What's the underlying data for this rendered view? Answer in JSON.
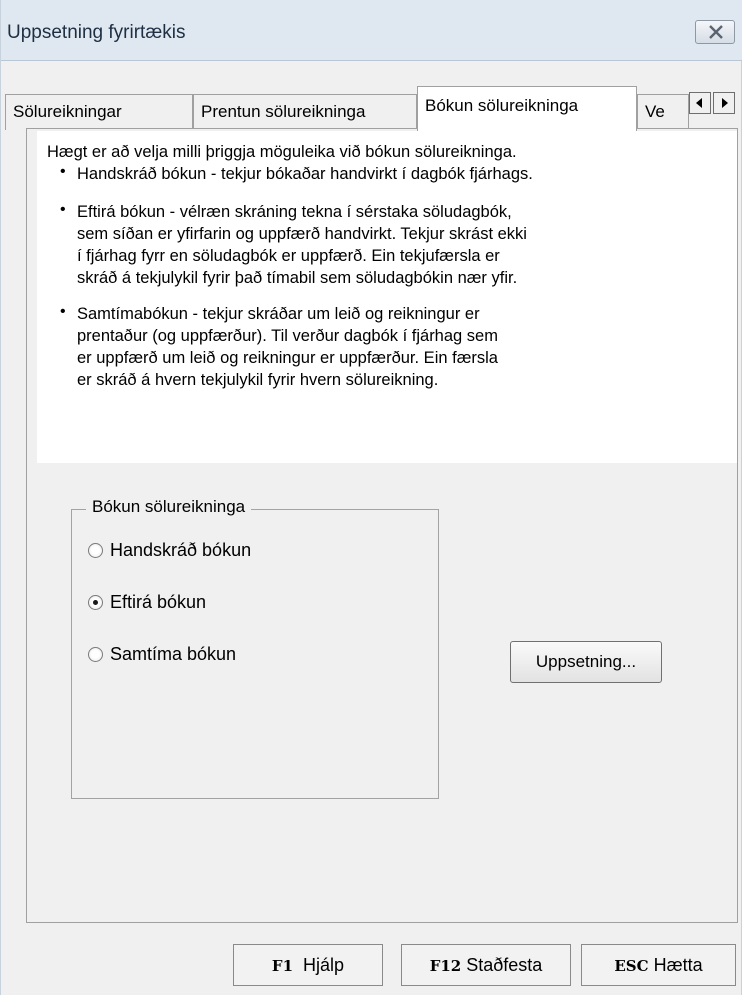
{
  "window": {
    "title": "Uppsetning fyrirtækis"
  },
  "tabs": [
    {
      "label": "Sölureikningar",
      "active": false
    },
    {
      "label": "Prentun sölureikninga",
      "active": false
    },
    {
      "label": "Bókun sölureikninga",
      "active": true
    },
    {
      "label": "Ve",
      "active": false
    }
  ],
  "info": {
    "intro": "Hægt er að velja milli þriggja möguleika við bókun sölureikninga.",
    "bullets": [
      {
        "lines": [
          "Handskráð bókun - tekjur bókaðar handvirkt í dagbók fjárhags."
        ]
      },
      {
        "lines": [
          "Eftirá bókun - vélræn skráning tekna í sérstaka söludagbók,",
          "sem síðan er yfirfarin og uppfærð handvirkt.  Tekjur skrást ekki",
          "í fjárhag fyrr en söludagbók er uppfærð.  Ein tekjufærsla er",
          "skráð á tekjulykil fyrir það tímabil sem söludagbókin nær yfir."
        ]
      },
      {
        "lines": [
          "Samtímabókun - tekjur skráðar um leið og reikningur er",
          "prentaður (og uppfærður).  Til verður dagbók í fjárhag sem",
          "er uppfærð um leið og reikningur er uppfærður.  Ein færsla",
          "er skráð á hvern tekjulykil fyrir hvern sölureikning."
        ]
      }
    ]
  },
  "booking_group": {
    "legend": "Bókun sölureikninga",
    "options": [
      {
        "label": "Handskráð bókun",
        "checked": false
      },
      {
        "label": "Eftirá bókun",
        "checked": true
      },
      {
        "label": "Samtíma bókun",
        "checked": false
      }
    ]
  },
  "setup_button": "Uppsetning...",
  "footer": {
    "help": {
      "key": "F1",
      "label": "Hjálp"
    },
    "confirm": {
      "key": "F12",
      "label": "Staðfesta"
    },
    "cancel": {
      "key": "ESC",
      "label": "Hætta"
    }
  },
  "icons": {
    "close": "close-icon",
    "scroll_left": "arrow-left-icon",
    "scroll_right": "arrow-right-icon"
  }
}
